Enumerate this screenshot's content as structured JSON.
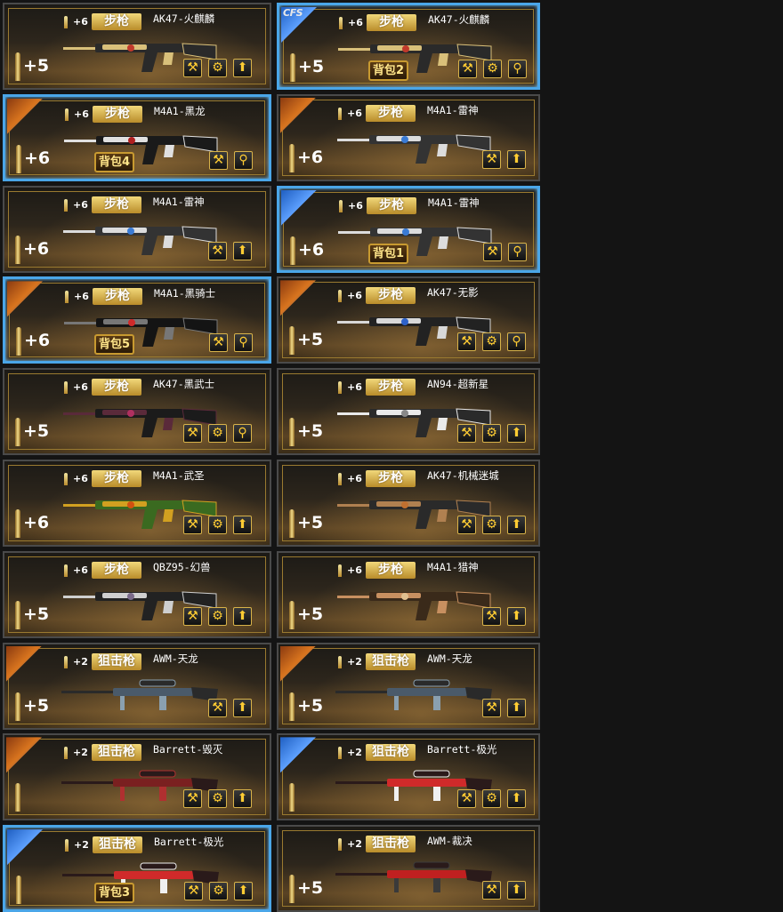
{
  "cards": [
    {
      "bonus_top": "+6",
      "type": "步枪",
      "name": "AK47-火麒麟",
      "plus": "+5",
      "buttons": [
        "wrench-icon",
        "gear-icon",
        "upgrade-arrow-icon"
      ],
      "bag": "",
      "selected": false,
      "corner": "",
      "logo": ""
    },
    {
      "bonus_top": "+6",
      "type": "步枪",
      "name": "AK47-火麒麟",
      "plus": "+5",
      "buttons": [
        "wrench-icon",
        "gear-icon",
        "search-icon"
      ],
      "bag": "背包2",
      "selected": true,
      "corner": "blue",
      "logo": "CFS"
    },
    {
      "bonus_top": "+6",
      "type": "步枪",
      "name": "M4A1-黑龙",
      "plus": "+6",
      "buttons": [
        "wrench-icon",
        "search-icon"
      ],
      "bag": "背包4",
      "selected": true,
      "corner": "orange",
      "logo": ""
    },
    {
      "bonus_top": "+6",
      "type": "步枪",
      "name": "M4A1-雷神",
      "plus": "+6",
      "buttons": [
        "wrench-icon",
        "upgrade-arrow-icon"
      ],
      "bag": "",
      "selected": false,
      "corner": "orange",
      "logo": ""
    },
    {
      "bonus_top": "+6",
      "type": "步枪",
      "name": "M4A1-雷神",
      "plus": "+6",
      "buttons": [
        "wrench-icon",
        "upgrade-arrow-icon"
      ],
      "bag": "",
      "selected": false,
      "corner": "",
      "logo": ""
    },
    {
      "bonus_top": "+6",
      "type": "步枪",
      "name": "M4A1-雷神",
      "plus": "+6",
      "buttons": [
        "wrench-icon",
        "search-icon"
      ],
      "bag": "背包1",
      "selected": true,
      "corner": "blue",
      "logo": ""
    },
    {
      "bonus_top": "+6",
      "type": "步枪",
      "name": "M4A1-黑骑士",
      "plus": "+6",
      "buttons": [
        "wrench-icon",
        "search-icon"
      ],
      "bag": "背包5",
      "selected": true,
      "corner": "orange",
      "logo": ""
    },
    {
      "bonus_top": "+6",
      "type": "步枪",
      "name": "AK47-无影",
      "plus": "+5",
      "buttons": [
        "wrench-icon",
        "gear-icon",
        "search-icon"
      ],
      "bag": "",
      "selected": false,
      "corner": "orange",
      "logo": ""
    },
    {
      "bonus_top": "+6",
      "type": "步枪",
      "name": "AK47-黑武士",
      "plus": "+5",
      "buttons": [
        "wrench-icon",
        "gear-icon",
        "search-icon"
      ],
      "bag": "",
      "selected": false,
      "corner": "",
      "logo": ""
    },
    {
      "bonus_top": "+6",
      "type": "步枪",
      "name": "AN94-超新星",
      "plus": "+5",
      "buttons": [
        "wrench-icon",
        "gear-icon",
        "upgrade-arrow-icon"
      ],
      "bag": "",
      "selected": false,
      "corner": "",
      "logo": ""
    },
    {
      "bonus_top": "+6",
      "type": "步枪",
      "name": "M4A1-武圣",
      "plus": "+6",
      "buttons": [
        "wrench-icon",
        "gear-icon",
        "upgrade-arrow-icon"
      ],
      "bag": "",
      "selected": false,
      "corner": "",
      "logo": ""
    },
    {
      "bonus_top": "+6",
      "type": "步枪",
      "name": "AK47-机械迷城",
      "plus": "+5",
      "buttons": [
        "wrench-icon",
        "gear-icon",
        "upgrade-arrow-icon"
      ],
      "bag": "",
      "selected": false,
      "corner": "",
      "logo": ""
    },
    {
      "bonus_top": "+6",
      "type": "步枪",
      "name": "QBZ95-幻兽",
      "plus": "+5",
      "buttons": [
        "wrench-icon",
        "gear-icon",
        "upgrade-arrow-icon"
      ],
      "bag": "",
      "selected": false,
      "corner": "",
      "logo": ""
    },
    {
      "bonus_top": "+6",
      "type": "步枪",
      "name": "M4A1-猎神",
      "plus": "+5",
      "buttons": [
        "wrench-icon",
        "upgrade-arrow-icon"
      ],
      "bag": "",
      "selected": false,
      "corner": "",
      "logo": ""
    },
    {
      "bonus_top": "+2",
      "type": "狙击枪",
      "name": "AWM-天龙",
      "plus": "+5",
      "buttons": [
        "wrench-icon",
        "upgrade-arrow-icon"
      ],
      "bag": "",
      "selected": false,
      "corner": "orange",
      "logo": ""
    },
    {
      "bonus_top": "+2",
      "type": "狙击枪",
      "name": "AWM-天龙",
      "plus": "+5",
      "buttons": [
        "wrench-icon",
        "upgrade-arrow-icon"
      ],
      "bag": "",
      "selected": false,
      "corner": "orange",
      "logo": ""
    },
    {
      "bonus_top": "+2",
      "type": "狙击枪",
      "name": "Barrett-毁灭",
      "plus": "",
      "buttons": [
        "wrench-icon",
        "gear-icon",
        "upgrade-arrow-icon"
      ],
      "bag": "",
      "selected": false,
      "corner": "orange",
      "logo": ""
    },
    {
      "bonus_top": "+2",
      "type": "狙击枪",
      "name": "Barrett-极光",
      "plus": "",
      "buttons": [
        "wrench-icon",
        "gear-icon",
        "upgrade-arrow-icon"
      ],
      "bag": "",
      "selected": false,
      "corner": "blue",
      "logo": ""
    },
    {
      "bonus_top": "+2",
      "type": "狙击枪",
      "name": "Barrett-极光",
      "plus": "",
      "buttons": [
        "wrench-icon",
        "gear-icon",
        "upgrade-arrow-icon"
      ],
      "bag": "背包3",
      "selected": true,
      "corner": "blue",
      "logo": ""
    },
    {
      "bonus_top": "+2",
      "type": "狙击枪",
      "name": "AWM-裁决",
      "plus": "+5",
      "buttons": [
        "wrench-icon",
        "upgrade-arrow-icon"
      ],
      "bag": "",
      "selected": false,
      "corner": "",
      "logo": ""
    }
  ],
  "icons": {
    "wrench-icon": "⚒",
    "gear-icon": "⚙",
    "upgrade-arrow-icon": "⬆",
    "search-icon": "⚲"
  },
  "gun_palettes": [
    [
      "#2a2a2a",
      "#d9c07a",
      "#c0392b"
    ],
    [
      "#2a2a2a",
      "#d9c07a",
      "#c0392b"
    ],
    [
      "#1a1a1a",
      "#e0e0e0",
      "#b02020"
    ],
    [
      "#333",
      "#dcdcdc",
      "#3a7bd5"
    ],
    [
      "#333",
      "#dcdcdc",
      "#3a7bd5"
    ],
    [
      "#333",
      "#dcdcdc",
      "#3a7bd5"
    ],
    [
      "#141414",
      "#777",
      "#d02a2a"
    ],
    [
      "#222",
      "#d8d8d8",
      "#2e62c9"
    ],
    [
      "#1b1b1b",
      "#5a2a3a",
      "#b03060"
    ],
    [
      "#2a2a2a",
      "#eaeaea",
      "#888"
    ],
    [
      "#3a6a20",
      "#d2a020",
      "#d05010"
    ],
    [
      "#2a2a2a",
      "#b08050",
      "#c07030"
    ],
    [
      "#222",
      "#cfcfcf",
      "#7a6a8a"
    ],
    [
      "#3a2a1a",
      "#c89060",
      "#e0c090"
    ],
    [
      "#2a2a2a",
      "#4a5a6a",
      "#8aa0b0"
    ],
    [
      "#2a2a2a",
      "#4a5a6a",
      "#8aa0b0"
    ],
    [
      "#2a1a1a",
      "#7a2020",
      "#b03030"
    ],
    [
      "#2a1a1a",
      "#d02a2a",
      "#f0f0f0"
    ],
    [
      "#2a1a1a",
      "#d02a2a",
      "#f0f0f0"
    ],
    [
      "#2a1a1a",
      "#c02020",
      "#3a3a3a"
    ]
  ]
}
